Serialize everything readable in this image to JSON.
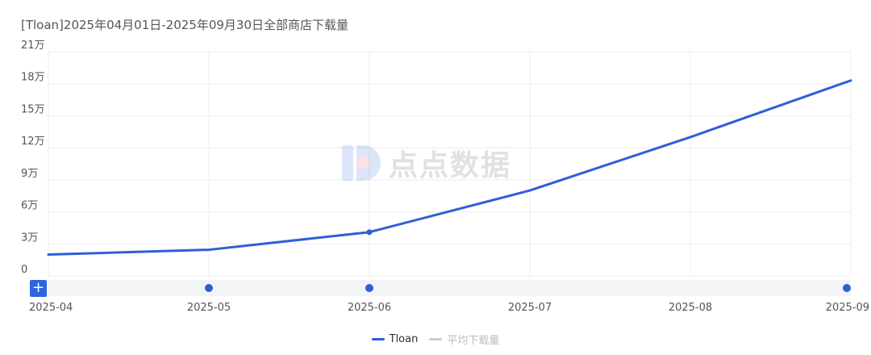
{
  "chart_data": {
    "type": "line",
    "title": "[Tloan]2025年04月01日-2025年09月30日全部商店下载量",
    "x": [
      "2025-04",
      "2025-05",
      "2025-06",
      "2025-07",
      "2025-08",
      "2025-09"
    ],
    "ylim": [
      0,
      210000
    ],
    "y_ticks": [
      {
        "value": 0,
        "label": "0"
      },
      {
        "value": 30000,
        "label": "3万"
      },
      {
        "value": 60000,
        "label": "6万"
      },
      {
        "value": 90000,
        "label": "9万"
      },
      {
        "value": 120000,
        "label": "12万"
      },
      {
        "value": 150000,
        "label": "15万"
      },
      {
        "value": 180000,
        "label": "18万"
      },
      {
        "value": 210000,
        "label": "21万"
      }
    ],
    "grid": true,
    "legend_position": "bottom-center",
    "series": [
      {
        "name": "Tloan",
        "color": "#2e5fd6",
        "values": [
          20000,
          24500,
          41000,
          80000,
          130000,
          183000
        ],
        "marked_points": [
          2
        ]
      },
      {
        "name": "平均下载量",
        "color": "#cccccc",
        "values": []
      }
    ],
    "event_markers": [
      "2025-05",
      "2025-06",
      "2025-09"
    ]
  },
  "toolbar": {
    "add_label": "+"
  },
  "watermark": {
    "text": "点点数据"
  }
}
